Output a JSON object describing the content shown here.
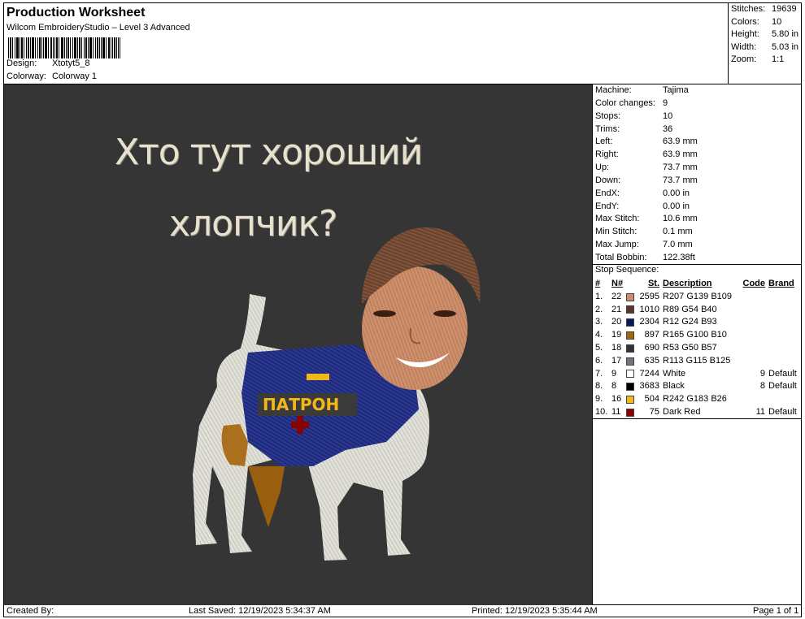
{
  "header": {
    "title": "Production Worksheet",
    "software": "Wilcom EmbroideryStudio – Level 3 Advanced",
    "design_label": "Design:",
    "design_value": "Xtotyt5_8",
    "colorway_label": "Colorway:",
    "colorway_value": "Colorway 1"
  },
  "stats": [
    {
      "label": "Stitches:",
      "value": "19639"
    },
    {
      "label": "Colors:",
      "value": "10"
    },
    {
      "label": "Height:",
      "value": "5.80 in"
    },
    {
      "label": "Width:",
      "value": "5.03 in"
    },
    {
      "label": "Zoom:",
      "value": "1:1"
    }
  ],
  "design": {
    "caption_line1": "Хто тут хороший",
    "caption_line2": "хлопчик?",
    "patch_text": "ПАТРОН"
  },
  "machine_info": [
    {
      "label": "Machine:",
      "value": "Tajima"
    },
    {
      "label": "Color changes:",
      "value": "9"
    },
    {
      "label": "Stops:",
      "value": "10"
    },
    {
      "label": "Trims:",
      "value": "36"
    },
    {
      "label": "Left:",
      "value": "63.9 mm"
    },
    {
      "label": "Right:",
      "value": "63.9 mm"
    },
    {
      "label": "Up:",
      "value": "73.7 mm"
    },
    {
      "label": "Down:",
      "value": "73.7 mm"
    },
    {
      "label": "EndX:",
      "value": "0.00 in"
    },
    {
      "label": "EndY:",
      "value": "0.00 in"
    },
    {
      "label": "Max Stitch:",
      "value": "10.6 mm"
    },
    {
      "label": "Min Stitch:",
      "value": "0.1 mm"
    },
    {
      "label": "Max Jump:",
      "value": "7.0 mm"
    },
    {
      "label": "Total Bobbin:",
      "value": "122.38ft"
    }
  ],
  "stop_sequence": {
    "title": "Stop Sequence:",
    "headers": {
      "idx": "#",
      "n": "N#",
      "st": "St.",
      "desc": "Description",
      "code": "Code",
      "brand": "Brand"
    },
    "rows": [
      {
        "idx": "1.",
        "n": "22",
        "color": "#cf8b6d",
        "st": "2595",
        "desc": "R207 G139 B109",
        "code": "",
        "brand": ""
      },
      {
        "idx": "2.",
        "n": "21",
        "color": "#593628",
        "st": "1010",
        "desc": "R89 G54 B40",
        "code": "",
        "brand": ""
      },
      {
        "idx": "3.",
        "n": "20",
        "color": "#0c185d",
        "st": "2304",
        "desc": "R12 G24 B93",
        "code": "",
        "brand": ""
      },
      {
        "idx": "4.",
        "n": "19",
        "color": "#a5640a",
        "st": "897",
        "desc": "R165 G100 B10",
        "code": "",
        "brand": ""
      },
      {
        "idx": "5.",
        "n": "18",
        "color": "#353239",
        "st": "690",
        "desc": "R53 G50 B57",
        "code": "",
        "brand": ""
      },
      {
        "idx": "6.",
        "n": "17",
        "color": "#71737d",
        "st": "635",
        "desc": "R113 G115 B125",
        "code": "",
        "brand": ""
      },
      {
        "idx": "7.",
        "n": "9",
        "color": "#ffffff",
        "st": "7244",
        "desc": "White",
        "code": "9",
        "brand": "Default"
      },
      {
        "idx": "8.",
        "n": "8",
        "color": "#000000",
        "st": "3683",
        "desc": "Black",
        "code": "8",
        "brand": "Default"
      },
      {
        "idx": "9.",
        "n": "16",
        "color": "#f2b71a",
        "st": "504",
        "desc": "R242 G183 B26",
        "code": "",
        "brand": ""
      },
      {
        "idx": "10.",
        "n": "11",
        "color": "#8b0000",
        "st": "75",
        "desc": "Dark Red",
        "code": "11",
        "brand": "Default"
      }
    ]
  },
  "footer": {
    "created_by": "Created By:",
    "last_saved": "Last Saved: 12/19/2023 5:34:37 AM",
    "printed": "Printed: 12/19/2023 5:35:44 AM",
    "page": "Page 1 of 1"
  }
}
